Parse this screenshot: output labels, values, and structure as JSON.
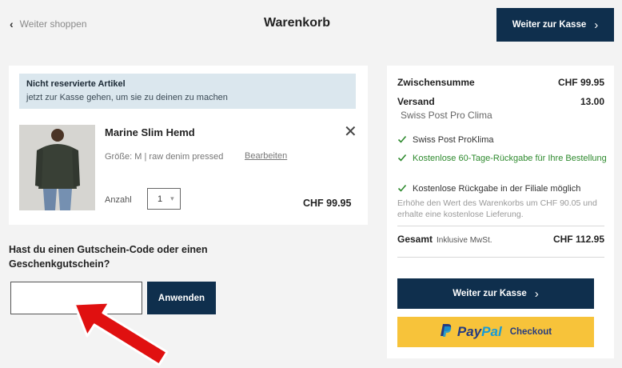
{
  "header": {
    "back_label": "Weiter shoppen",
    "title": "Warenkorb",
    "checkout_label": "Weiter zur Kasse"
  },
  "cart": {
    "notice_title": "Nicht reservierte Artikel",
    "notice_text": "jetzt zur Kasse gehen, um sie zu deinen zu machen",
    "item": {
      "name": "Marine Slim Hemd",
      "meta": "Größe: M | raw denim pressed",
      "edit_label": "Bearbeiten",
      "qty_label": "Anzahl",
      "qty_value": "1",
      "price": "CHF 99.95"
    }
  },
  "voucher": {
    "heading": "Hast du einen Gutschein-Code oder einen Geschenkgutschein?",
    "input_value": "",
    "apply_label": "Anwenden"
  },
  "summary": {
    "subtotal_label": "Zwischensumme",
    "subtotal_value": "CHF 99.95",
    "shipping_label": "Versand",
    "shipping_value": "13.00",
    "shipping_method": "Swiss Post Pro Clima",
    "benefits": [
      "Swiss Post ProKlima",
      "Kostenlose 60-Tage-Rückgabe für Ihre Bestellung",
      "Kostenlose Rückgabe in der Filiale möglich"
    ],
    "free_shipping_note": "Erhöhe den Wert des Warenkorbs um CHF 90.05 und erhalte eine kostenlose Lieferung.",
    "total_label": "Gesamt",
    "total_sub": "Inklusive MwSt.",
    "total_value": "CHF 112.95",
    "checkout_label": "Weiter zur Kasse",
    "paypal_pay": "Pay",
    "paypal_pal": "Pal",
    "paypal_checkout": "Checkout"
  },
  "colors": {
    "navy": "#0f2f4d",
    "paypal_yellow": "#f7c33a",
    "notice_bg": "#dbe7ee",
    "check_green": "#2e8a2e",
    "arrow_red": "#e01010"
  }
}
